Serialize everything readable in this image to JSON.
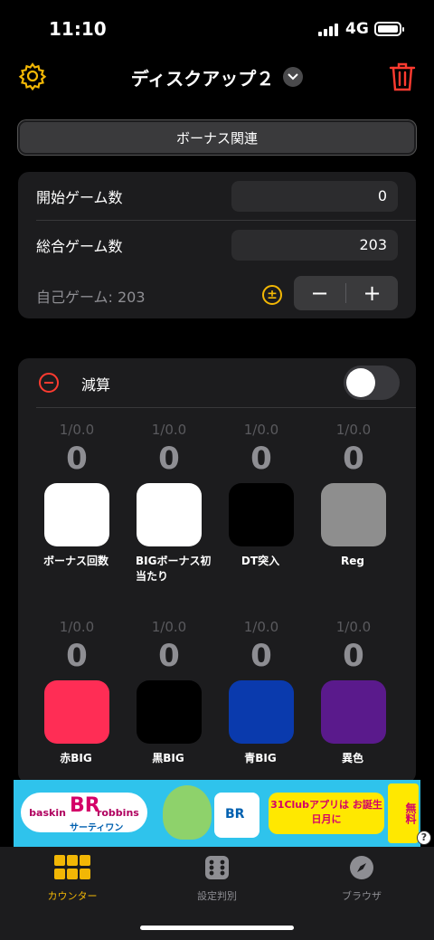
{
  "status": {
    "time": "11:10",
    "network": "4G"
  },
  "header": {
    "title": "ディスクアップ２"
  },
  "section_button": "ボーナス関連",
  "games": {
    "start_label": "開始ゲーム数",
    "start_value": "0",
    "total_label": "総合ゲーム数",
    "total_value": "203",
    "self_label": "自己ゲーム: 203",
    "stepper_minus": "−",
    "stepper_plus": "+"
  },
  "subtract": {
    "label": "減算",
    "enabled": false
  },
  "counters": [
    {
      "ratio": "1/0.0",
      "count": "0",
      "name": "ボーナス回数",
      "color": "#ffffff"
    },
    {
      "ratio": "1/0.0",
      "count": "0",
      "name": "BIGボーナス初当たり",
      "color": "#ffffff"
    },
    {
      "ratio": "1/0.0",
      "count": "0",
      "name": "DT突入",
      "color": "#000000"
    },
    {
      "ratio": "1/0.0",
      "count": "0",
      "name": "Reg",
      "color": "#8e8e8e"
    },
    {
      "ratio": "1/0.0",
      "count": "0",
      "name": "赤BIG",
      "color": "#ff2d55"
    },
    {
      "ratio": "1/0.0",
      "count": "0",
      "name": "黒BIG",
      "color": "#000000"
    },
    {
      "ratio": "1/0.0",
      "count": "0",
      "name": "青BIG",
      "color": "#0a3aad"
    },
    {
      "ratio": "1/0.0",
      "count": "0",
      "name": "異色",
      "color": "#5a1a8c"
    }
  ],
  "ad": {
    "brand_left": "baskin",
    "brand_mark": "BR",
    "brand_right": "robbins",
    "brand_sub": "サーティワン",
    "promo": "31Clubアプリは お誕生日月に",
    "free": "無料",
    "info": "?"
  },
  "tabs": [
    {
      "label": "カウンター",
      "active": true
    },
    {
      "label": "設定判別",
      "active": false
    },
    {
      "label": "ブラウザ",
      "active": false
    }
  ],
  "colors": {
    "accent": "#f2b705",
    "danger": "#ff3b30",
    "inactive": "#8e8e93"
  }
}
